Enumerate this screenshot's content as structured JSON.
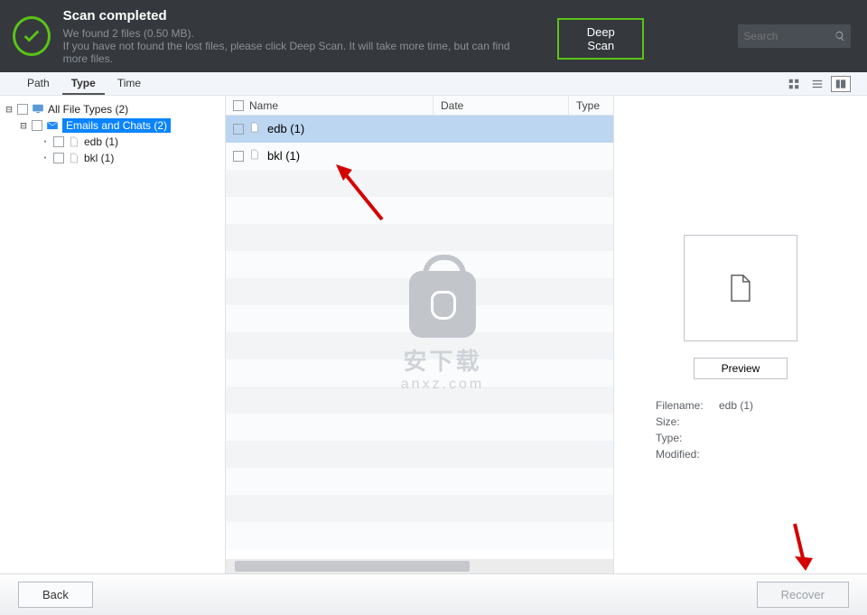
{
  "header": {
    "title": "Scan completed",
    "sub1": "We found 2 files (0.50 MB).",
    "sub2": "If you have not found the lost files, please click Deep Scan. It will take more time, but can find more files.",
    "deep_scan": "Deep Scan",
    "search_placeholder": "Search"
  },
  "tabs": {
    "path": "Path",
    "type": "Type",
    "time": "Time",
    "active": "type"
  },
  "tree": {
    "root": "All File Types (2)",
    "emails": "Emails and Chats (2)",
    "items": [
      "edb (1)",
      "bkl (1)"
    ]
  },
  "list": {
    "cols": {
      "name": "Name",
      "date": "Date",
      "type": "Type"
    },
    "rows": [
      {
        "name": "edb (1)",
        "selected": true
      },
      {
        "name": "bkl (1)",
        "selected": false
      }
    ]
  },
  "preview": {
    "button": "Preview",
    "filename_label": "Filename:",
    "size_label": "Size:",
    "type_label": "Type:",
    "modified_label": "Modified:",
    "filename_value": "edb (1)",
    "size_value": "",
    "type_value": "",
    "modified_value": ""
  },
  "footer": {
    "back": "Back",
    "recover": "Recover"
  },
  "watermark": {
    "cn": "安下载",
    "url": "anxz.com"
  }
}
